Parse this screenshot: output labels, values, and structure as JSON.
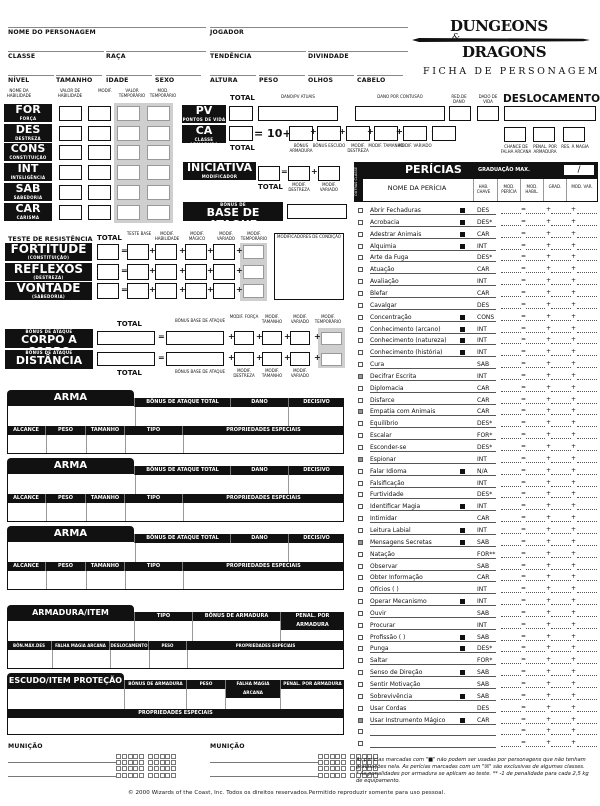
{
  "header": {
    "logo_line1": "DUNGEONS",
    "logo_amp": "&",
    "logo_line2": "DRAGONS",
    "subtitle": "FICHA DE PERSONAGEM",
    "fields_row1": [
      "NOME DO PERSONAGEM",
      "JOGADOR"
    ],
    "fields_row2": [
      "CLASSE",
      "RAÇA",
      "TENDÊNCIA",
      "DIVINDADE"
    ],
    "fields_row3": [
      "NÍVEL",
      "TAMANHO",
      "IDADE",
      "SEXO",
      "ALTURA",
      "PESO",
      "OLHOS",
      "CABELO"
    ]
  },
  "abilities": {
    "col_headers": [
      "NOME DA HABILIDADE",
      "VALOR DE HABILIDADE",
      "MODIF.",
      "VALOR TEMPORÁRIO",
      "MOD. TEMPORÁRIO"
    ],
    "items": [
      {
        "abbr": "FOR",
        "name": "FORÇA"
      },
      {
        "abbr": "DES",
        "name": "DESTREZA"
      },
      {
        "abbr": "CONS",
        "name": "CONSTITUIÇÃO"
      },
      {
        "abbr": "INT",
        "name": "INTELIGÊNCIA"
      },
      {
        "abbr": "SAB",
        "name": "SABEDORIA"
      },
      {
        "abbr": "CAR",
        "name": "CARISMA"
      }
    ]
  },
  "hp": {
    "abbr": "PV",
    "name": "PONTOS DE VIDA",
    "total": "TOTAL",
    "current": "DANO/PV ATUAIS",
    "subdual": "DANO POR CONTUSÃO",
    "dr": "RED.DE DANO",
    "hd": "DADO DE VIDA"
  },
  "speed": {
    "title": "DESLOCAMENTO",
    "arcane": "CHANCE DE FALHA ARCANA",
    "penalty": "PENAL. POR ARMADURA",
    "sr": "RES. À MAGIA"
  },
  "ac": {
    "abbr": "CA",
    "name": "CLASSE ARMADURA",
    "total": "TOTAL",
    "base": "= 10+",
    "parts": [
      "BÔNUS ARMADURA",
      "BÔNUS ESCUDO",
      "MODIF. DESTREZA",
      "MODIF. TAMANHO",
      "MODIF. VARIADO"
    ]
  },
  "initiative": {
    "title": "INICIATIVA",
    "sub": "MODIFICADOR",
    "total": "TOTAL",
    "parts": [
      "MODIF. DESTREZA",
      "MODIF. VARIADO"
    ]
  },
  "bab": {
    "sub": "BÔNUS DE",
    "title": "BASE DE ATAQUE"
  },
  "saves": {
    "title": "TESTE DE RESISTÊNCIA",
    "total": "TOTAL",
    "cols": [
      "TESTE BASE",
      "MODIF. HABILIDADE",
      "MODIF. MÁGICO",
      "MODIF. VARIADO",
      "MODIF. TEMPORÁRIO"
    ],
    "cond": "MODIFICADORES DE CONDIÇÃO",
    "items": [
      {
        "name": "FORTITUDE",
        "sub": "(CONSTITUIÇÃO)"
      },
      {
        "name": "REFLEXOS",
        "sub": "(DESTREZA)"
      },
      {
        "name": "VONTADE",
        "sub": "(SABEDORIA)"
      }
    ]
  },
  "attack": {
    "total": "TOTAL",
    "bab": "BÔNUS BASE DE ATAQUE",
    "sub": "BÔNUS DE ATAQUE",
    "melee": {
      "name": "CORPO A CORPO",
      "cols": [
        "MODIF. FORÇA",
        "MODIF. TAMANHO",
        "MODIF. VARIADO",
        "MODIF. TEMPORÁRIO"
      ]
    },
    "ranged": {
      "name": "DISTÂNCIA",
      "cols": [
        "MODIF. DESTREZA",
        "MODIF. TAMANHO",
        "MODIF. VARIADO"
      ]
    }
  },
  "weapons": {
    "title": "ARMA",
    "top": [
      "BÔNUS DE ATAQUE TOTAL",
      "DANO",
      "DECISIVO"
    ],
    "bottom": [
      "ALCANCE",
      "PESO",
      "TAMANHO",
      "TIPO",
      "PROPRIEDADES ESPECIAIS"
    ],
    "count": 3
  },
  "armor": {
    "title": "ARMADURA/ITEM PROTEÇÃO",
    "top": [
      "TIPO",
      "BÔNUS DE ARMADURA",
      "PENAL. POR ARMADURA"
    ],
    "bottom": [
      "BÔN.MÁX.DES",
      "FALHA MAGIA ARCANA",
      "DESLOCAMENTO",
      "PESO",
      "PROPRIEDADES ESPECIAIS"
    ]
  },
  "shield": {
    "title": "ESCUDO/ITEM PROTEÇÃO",
    "top": [
      "BÔNUS DE ARMADURA",
      "PESO",
      "FALHA MAGIA ARCANA",
      "PENAL. POR ARMADURA"
    ],
    "bottom": "PROPRIEDADES ESPECIAIS"
  },
  "ammo": {
    "label": "MUNIÇÃO"
  },
  "skills": {
    "title": "PERÍCIAS",
    "side": "OUTRAS CLASSE",
    "max": "GRADUAÇÃO MAX.",
    "max_sep": "/",
    "cols": [
      "NOME DA PERÍCIA",
      "HAB. CHAVE",
      "MOD. PERÍCIA",
      "MOD. HABIL.",
      "GRAD.",
      "MOD. VAR."
    ],
    "items": [
      {
        "n": "Abrir Fechaduras",
        "a": "DES",
        "t": 1,
        "c": 0
      },
      {
        "n": "Acrobacia",
        "a": "DES*",
        "t": 1,
        "c": 0
      },
      {
        "n": "Adestrar Animais",
        "a": "CAR",
        "t": 1,
        "c": 0
      },
      {
        "n": "Alquimia",
        "a": "INT",
        "t": 1,
        "c": 0
      },
      {
        "n": "Arte da Fuga",
        "a": "DES*",
        "t": 0,
        "c": 0
      },
      {
        "n": "Atuação",
        "a": "CAR",
        "t": 0,
        "c": 0
      },
      {
        "n": "Avaliação",
        "a": "INT",
        "t": 0,
        "c": 0
      },
      {
        "n": "Blefar",
        "a": "CAR",
        "t": 0,
        "c": 0
      },
      {
        "n": "Cavalgar",
        "a": "DES",
        "t": 0,
        "c": 0
      },
      {
        "n": "Concentração",
        "a": "CONS",
        "t": 1,
        "c": 0
      },
      {
        "n": "Conhecimento (arcano)",
        "a": "INT",
        "t": 1,
        "c": 0
      },
      {
        "n": "Conhecimento (natureza)",
        "a": "INT",
        "t": 1,
        "c": 0
      },
      {
        "n": "Conhecimento (história)",
        "a": "INT",
        "t": 1,
        "c": 0
      },
      {
        "n": "Cura",
        "a": "SAB",
        "t": 0,
        "c": 0
      },
      {
        "n": "Decifrar Escrita",
        "a": "INT",
        "t": 0,
        "c": 1
      },
      {
        "n": "Diplomacia",
        "a": "CAR",
        "t": 0,
        "c": 0
      },
      {
        "n": "Disfarce",
        "a": "CAR",
        "t": 0,
        "c": 0
      },
      {
        "n": "Empatia com Animais",
        "a": "CAR",
        "t": 0,
        "c": 1
      },
      {
        "n": "Equilíbrio",
        "a": "DES*",
        "t": 0,
        "c": 0
      },
      {
        "n": "Escalar",
        "a": "FOR*",
        "t": 0,
        "c": 0
      },
      {
        "n": "Esconder-se",
        "a": "DES*",
        "t": 0,
        "c": 0
      },
      {
        "n": "Espionar",
        "a": "INT",
        "t": 0,
        "c": 1
      },
      {
        "n": "Falar Idioma",
        "a": "N/A",
        "t": 1,
        "c": 0
      },
      {
        "n": "Falsificação",
        "a": "INT",
        "t": 0,
        "c": 0
      },
      {
        "n": "Furtividade",
        "a": "DES*",
        "t": 0,
        "c": 0
      },
      {
        "n": "Identificar Magia",
        "a": "INT",
        "t": 1,
        "c": 0
      },
      {
        "n": "Intimidar",
        "a": "CAR",
        "t": 0,
        "c": 0
      },
      {
        "n": "Leitura Labial",
        "a": "INT",
        "t": 1,
        "c": 0
      },
      {
        "n": "Mensagens Secretas",
        "a": "SAB",
        "t": 1,
        "c": 1
      },
      {
        "n": "Natação",
        "a": "FOR**",
        "t": 0,
        "c": 0
      },
      {
        "n": "Observar",
        "a": "SAB",
        "t": 0,
        "c": 0
      },
      {
        "n": "Obter Informação",
        "a": "CAR",
        "t": 0,
        "c": 0
      },
      {
        "n": "Ofícios (                    )",
        "a": "INT",
        "t": 0,
        "c": 0
      },
      {
        "n": "Operar Mecanismo",
        "a": "INT",
        "t": 1,
        "c": 0
      },
      {
        "n": "Ouvir",
        "a": "SAB",
        "t": 0,
        "c": 0
      },
      {
        "n": "Procurar",
        "a": "INT",
        "t": 0,
        "c": 0
      },
      {
        "n": "Profissão (                 )",
        "a": "SAB",
        "t": 1,
        "c": 0
      },
      {
        "n": "Punga",
        "a": "DES*",
        "t": 1,
        "c": 0
      },
      {
        "n": "Saltar",
        "a": "FOR*",
        "t": 0,
        "c": 0
      },
      {
        "n": "Senso de Direção",
        "a": "SAB",
        "t": 1,
        "c": 0
      },
      {
        "n": "Sentir Motivação",
        "a": "SAB",
        "t": 0,
        "c": 0
      },
      {
        "n": "Sobrevivência",
        "a": "SAB",
        "t": 1,
        "c": 0
      },
      {
        "n": "Usar Cordas",
        "a": "DES",
        "t": 0,
        "c": 0
      },
      {
        "n": "Usar Instrumento Mágico",
        "a": "CAR",
        "t": 1,
        "c": 1
      },
      {
        "n": "",
        "a": "",
        "t": 0,
        "c": 0
      },
      {
        "n": "",
        "a": "",
        "t": 0,
        "c": 0
      }
    ],
    "notes": [
      "As perícias marcadas com \"■\" não podem ser usadas por personagens que não tenham graduações nela. As perícias marcadas com um \"☒\" são exclusivas de algumas classes.",
      "* As penalidades por armadura se aplicam ao teste. ** -1 de penalidade para cada 2,5 kg de equipamento."
    ]
  },
  "footer": "© 2000 Wizards of the Coast, Inc. Todos os direitos reservados.Permitido reproduzir somente para uso pessoal."
}
